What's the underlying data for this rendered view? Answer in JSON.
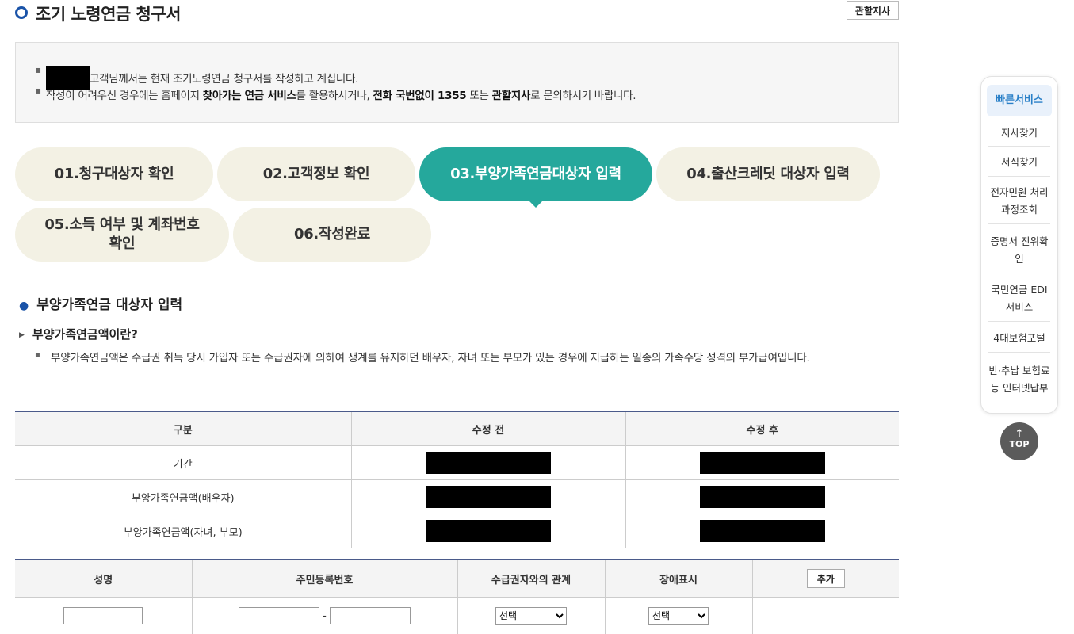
{
  "header": {
    "title": "조기 노령연금 청구서",
    "branch_button": "관할지사"
  },
  "notice": {
    "line1_text": "고객님께서는 현재 조기노령연금 청구서를 작성하고 계십니다.",
    "line2_pre": "작성이 어려우신 경우에는 홈페이지 ",
    "line2_b1": "찾아가는 연금 서비스",
    "line2_mid1": "를 활용하시거나, ",
    "line2_b2": "전화 국번없이 1355",
    "line2_mid2": " 또는 ",
    "line2_b3": "관할지사",
    "line2_post": "로 문의하시기 바랍니다."
  },
  "steps": [
    {
      "label": "01.청구대상자 확인",
      "active": false
    },
    {
      "label": "02.고객정보 확인",
      "active": false
    },
    {
      "label": "03.부양가족연금대상자 입력",
      "active": true
    },
    {
      "label": "04.출산크레딧 대상자 입력",
      "active": false
    },
    {
      "label": "05.소득 여부 및 계좌번호 확인",
      "active": false
    },
    {
      "label": "06.작성완료",
      "active": false
    }
  ],
  "section": {
    "title": "부양가족연금 대상자 입력",
    "sub_title": "부양가족연금액이란?",
    "description": "부양가족연금액은 수급권 취득 당시 가입자 또는 수급권자에 의하여 생계를 유지하던 배우자, 자녀 또는 부모가 있는 경우에 지급하는 일종의 가족수당 성격의 부가급여입니다."
  },
  "compare_table": {
    "headers": [
      "구분",
      "수정 전",
      "수정 후"
    ],
    "rows": [
      "기간",
      "부양가족연금액(배우자)",
      "부양가족연금액(자녀, 부모)"
    ]
  },
  "input_table": {
    "headers": [
      "성명",
      "주민등록번호",
      "수급권자와의 관계",
      "장애표시"
    ],
    "add_button": "추가",
    "dash": "-",
    "relation_select": "선택",
    "disability_select": "선택"
  },
  "quick_menu": {
    "title": "빠른서비스",
    "items": [
      "지사찾기",
      "서식찾기",
      "전자민원 처리과정조회",
      "증명서 진위확인",
      "국민연금 EDI서비스",
      "4대보험포털",
      "반·추납 보험료 등 인터넷납부"
    ]
  },
  "top_button": {
    "arrow": "↑",
    "label": "TOP"
  },
  "colors": {
    "accent": "#25a89c",
    "step_bg": "#f3f1e4",
    "quick_accent": "#2a80c8"
  }
}
